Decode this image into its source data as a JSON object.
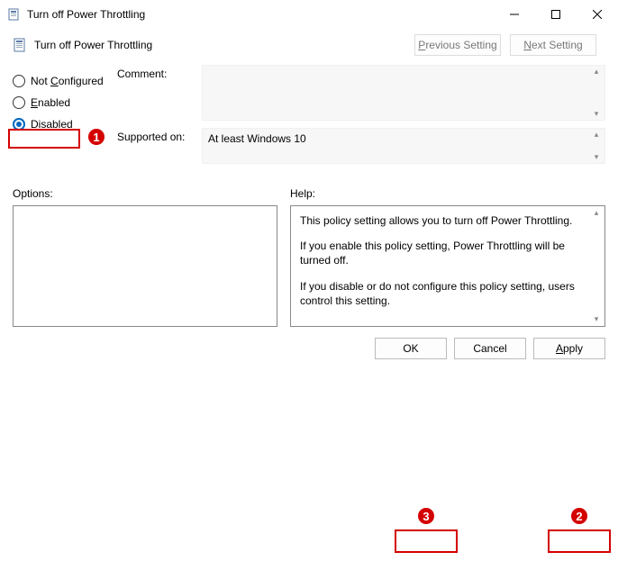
{
  "window": {
    "title": "Turn off Power Throttling"
  },
  "subheader": {
    "title": "Turn off Power Throttling"
  },
  "nav": {
    "prev_u": "P",
    "prev_rest": "revious Setting",
    "next_u": "N",
    "next_rest": "ext Setting"
  },
  "radios": {
    "not_configured_u": "C",
    "not_configured_pre": "Not ",
    "not_configured_rest": "onfigured",
    "enabled_u": "E",
    "enabled_rest": "nabled",
    "disabled_u": "D",
    "disabled_rest": "isabled",
    "selected": "disabled"
  },
  "fields": {
    "comment_label": "Comment:",
    "comment_value": "",
    "supported_label": "Supported on:",
    "supported_value": "At least Windows 10"
  },
  "columns": {
    "options_label": "Options:",
    "help_label": "Help:"
  },
  "help": {
    "p1": "This policy setting allows you to turn off Power Throttling.",
    "p2": "If you enable this policy setting, Power Throttling will be turned off.",
    "p3": "If you disable or do not configure this policy setting, users control this setting."
  },
  "footer": {
    "ok": "OK",
    "cancel": "Cancel",
    "apply_u": "A",
    "apply_rest": "pply"
  },
  "annotations": {
    "n1": "1",
    "n2": "2",
    "n3": "3"
  }
}
